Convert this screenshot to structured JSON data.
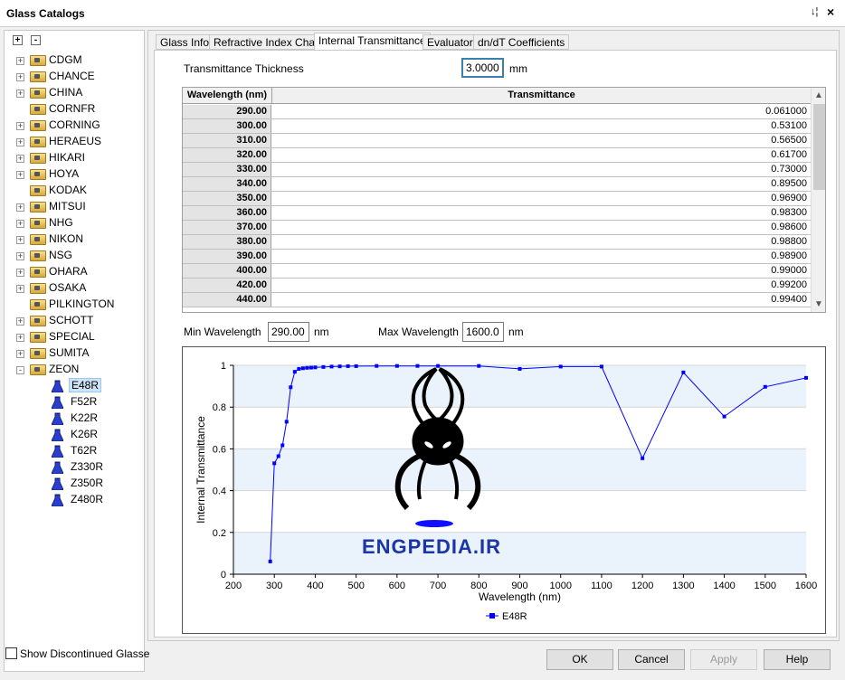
{
  "window": {
    "title": "Glass Catalogs",
    "pin_glyph": "↓¦",
    "close_glyph": "×"
  },
  "tree_toolbar": {
    "expand_label": "+",
    "collapse_label": "-"
  },
  "catalogs": [
    "CDGM",
    "CHANCE",
    "CHINA",
    "CORNFR",
    "CORNING",
    "HERAEUS",
    "HIKARI",
    "HOYA",
    "KODAK",
    "MITSUI",
    "NHG",
    "NIKON",
    "NSG",
    "OHARA",
    "OSAKA",
    "PILKINGTON",
    "SCHOTT",
    "SPECIAL",
    "SUMITA",
    "ZEON"
  ],
  "zeon_glasses": [
    "E48R",
    "F52R",
    "K22R",
    "K26R",
    "T62R",
    "Z330R",
    "Z350R",
    "Z480R"
  ],
  "selected_glass": "E48R",
  "show_discontinued_label": "Show Discontinued Glasse",
  "tabs": [
    "Glass Info",
    "Refractive Index Chart",
    "Internal Transmittance",
    "Evaluator",
    "dn/dT Coefficients"
  ],
  "active_tab": "Internal Transmittance",
  "thickness": {
    "label": "Transmittance Thickness",
    "value": "3.0000",
    "unit": "mm"
  },
  "table": {
    "headers": [
      "Wavelength (nm)",
      "Transmittance"
    ],
    "rows": [
      [
        "290.00",
        "0.061000"
      ],
      [
        "300.00",
        "0.53100"
      ],
      [
        "310.00",
        "0.56500"
      ],
      [
        "320.00",
        "0.61700"
      ],
      [
        "330.00",
        "0.73000"
      ],
      [
        "340.00",
        "0.89500"
      ],
      [
        "350.00",
        "0.96900"
      ],
      [
        "360.00",
        "0.98300"
      ],
      [
        "370.00",
        "0.98600"
      ],
      [
        "380.00",
        "0.98800"
      ],
      [
        "390.00",
        "0.98900"
      ],
      [
        "400.00",
        "0.99000"
      ],
      [
        "420.00",
        "0.99200"
      ],
      [
        "440.00",
        "0.99400"
      ]
    ]
  },
  "range": {
    "min_label": "Min Wavelength",
    "min_value": "290.00",
    "max_label": "Max Wavelength",
    "max_value": "1600.0",
    "unit": "nm"
  },
  "chart_data": {
    "type": "line",
    "xlabel": "Wavelength (nm)",
    "ylabel": "Internal Transmittance",
    "xlim": [
      200,
      1600
    ],
    "ylim": [
      0,
      1
    ],
    "xticks": [
      "200",
      "300",
      "400",
      "500",
      "600",
      "700",
      "800",
      "900",
      "1000",
      "1100",
      "1200",
      "1300",
      "1400",
      "1500",
      "1600"
    ],
    "yticks": [
      "0",
      "0.2",
      "0.4",
      "0.6",
      "0.8",
      "1"
    ],
    "grid": true,
    "legend": "bottom-center",
    "color": "#0000ff",
    "series": [
      {
        "name": "E48R",
        "x": [
          290,
          300,
          310,
          320,
          330,
          340,
          350,
          360,
          370,
          380,
          390,
          400,
          420,
          440,
          460,
          480,
          500,
          550,
          600,
          650,
          700,
          800,
          900,
          1000,
          1100,
          1200,
          1300,
          1400,
          1500,
          1600
        ],
        "y": [
          0.061,
          0.531,
          0.565,
          0.617,
          0.73,
          0.895,
          0.969,
          0.983,
          0.986,
          0.988,
          0.989,
          0.99,
          0.992,
          0.994,
          0.995,
          0.996,
          0.996,
          0.997,
          0.997,
          0.997,
          0.997,
          0.997,
          0.983,
          0.994,
          0.994,
          0.555,
          0.966,
          0.755,
          0.897,
          0.94
        ]
      }
    ]
  },
  "watermark": {
    "text": "ENGPEDIA.IR"
  },
  "buttons": {
    "ok": "OK",
    "cancel": "Cancel",
    "apply": "Apply",
    "help": "Help"
  }
}
